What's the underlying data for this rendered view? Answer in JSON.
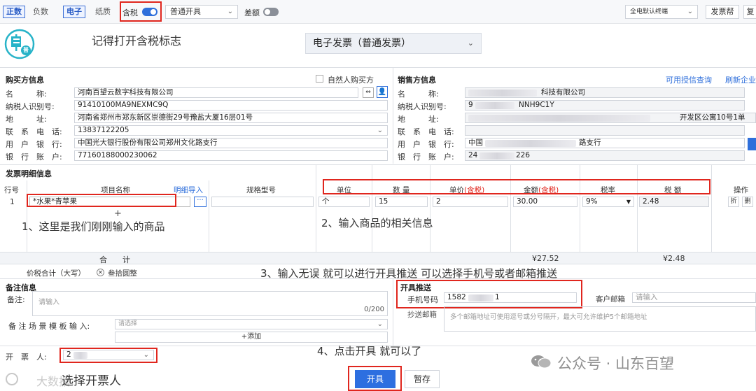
{
  "toolbar": {
    "tab_zhengshu": "正数",
    "tab_fushu": "负数",
    "tab_dianzi": "电子",
    "tab_zhizhi": "纸质",
    "tax_included_label": "含税",
    "invoice_mode": "普通开具",
    "diff_label": "差额",
    "right_select": "全电默认终端",
    "help_button": "发票帮",
    "more_button": "复"
  },
  "logo_text": "普",
  "annotations": {
    "top": "记得打开含税标志",
    "step1": "1、这里是我们刚刚输入的商品",
    "step2": "2、输入商品的相关信息",
    "step3": "3、输入无误 就可以进行开具推送 可以选择手机号或者邮箱推送",
    "step4": "4、点击开具 就可以了",
    "step5": "选择开票人"
  },
  "invoice_type": "电子发票（普通发票）",
  "buyer": {
    "title": "购买方信息",
    "natural_person_label": "自然人购买方",
    "name_label": "名　　　称:",
    "name": "河南百望云数字科技有限公司",
    "tax_id_label": "纳税人识别号:",
    "tax_id": "91410100MA9NEXMC9Q",
    "address_label": "地　　　址:",
    "address": "河南省郑州市郑东新区崇德街29号豫盐大厦16层01号",
    "phone_label": "联　系　电　话:",
    "phone": "13837122205",
    "bank_label": "用　户　银　行:",
    "bank": "中国光大银行股份有限公司郑州文化路支行",
    "account_label": "银　行　账　户:",
    "account": "77160188000230062"
  },
  "seller": {
    "title": "销售方信息",
    "credit_link": "可用授信查询",
    "refresh_link": "刷新企业",
    "name_label": "名　　　称:",
    "name": "科技有限公司",
    "tax_id_label": "纳税人识别号:",
    "tax_id_prefix": "9",
    "tax_id_suffix": "NNH9C1Y",
    "address_label": "地　　　址:",
    "address": "开发区公寓10号1单",
    "phone_label": "联　系　电　话:",
    "bank_label": "用　户　银　行:",
    "bank_prefix": "中国",
    "bank_suffix": "路支行",
    "account_label": "银　行　账　户:",
    "account_prefix": "24",
    "account_suffix": "226"
  },
  "detail": {
    "title": "发票明细信息",
    "headers": {
      "row_no": "行号",
      "item_name": "项目名称",
      "detail_import": "明细导入",
      "spec": "规格型号",
      "unit": "单位",
      "qty": "数 量",
      "price": "单价",
      "price_tag": "(含税)",
      "amount": "金额",
      "amount_tag": "(含税)",
      "tax_rate": "税率",
      "tax": "税 额",
      "ops": "操作"
    },
    "row": {
      "no": "1",
      "item_name": "*水果*青苹果",
      "unit": "个",
      "qty": "15",
      "price": "2",
      "amount": "30.00",
      "tax_rate": "9%",
      "tax": "2.48",
      "op1": "折",
      "op2": "删"
    },
    "add_row": "+",
    "total_label": "合　　计",
    "total_amount": "¥27.52",
    "total_tax": "¥2.48",
    "price_tax_label": "价税合计（大写）",
    "price_tax_value": "叁拾圆整"
  },
  "remarks": {
    "title": "备注信息",
    "label": "备注:",
    "placeholder": "请输入",
    "counter": "0/200",
    "template_label": "备 注 场 景 模 板 输 入:",
    "template_placeholder": "请选择",
    "add_button": "+添加"
  },
  "push": {
    "title": "开具推送",
    "phone_label": "手机号码",
    "phone": "1582",
    "phone_tail": "1",
    "email_label": "客户邮箱",
    "email_placeholder": "请输入",
    "cc_label": "抄送邮箱",
    "cc_placeholder": "多个邮箱地址可使用逗号或分号隔开，最大可允许维护5个邮箱地址"
  },
  "issuer": {
    "label": "开　票　人:",
    "value": "2"
  },
  "actions": {
    "issue": "开具",
    "save_draft": "暂存"
  },
  "watermark": {
    "left": "大数据",
    "right": "公众号 · 山东百望"
  },
  "colors": {
    "accent": "#2f6fdb",
    "annotation": "#e0261e",
    "primary_button": "#2d6fe0",
    "logo": "#27b3c8"
  }
}
